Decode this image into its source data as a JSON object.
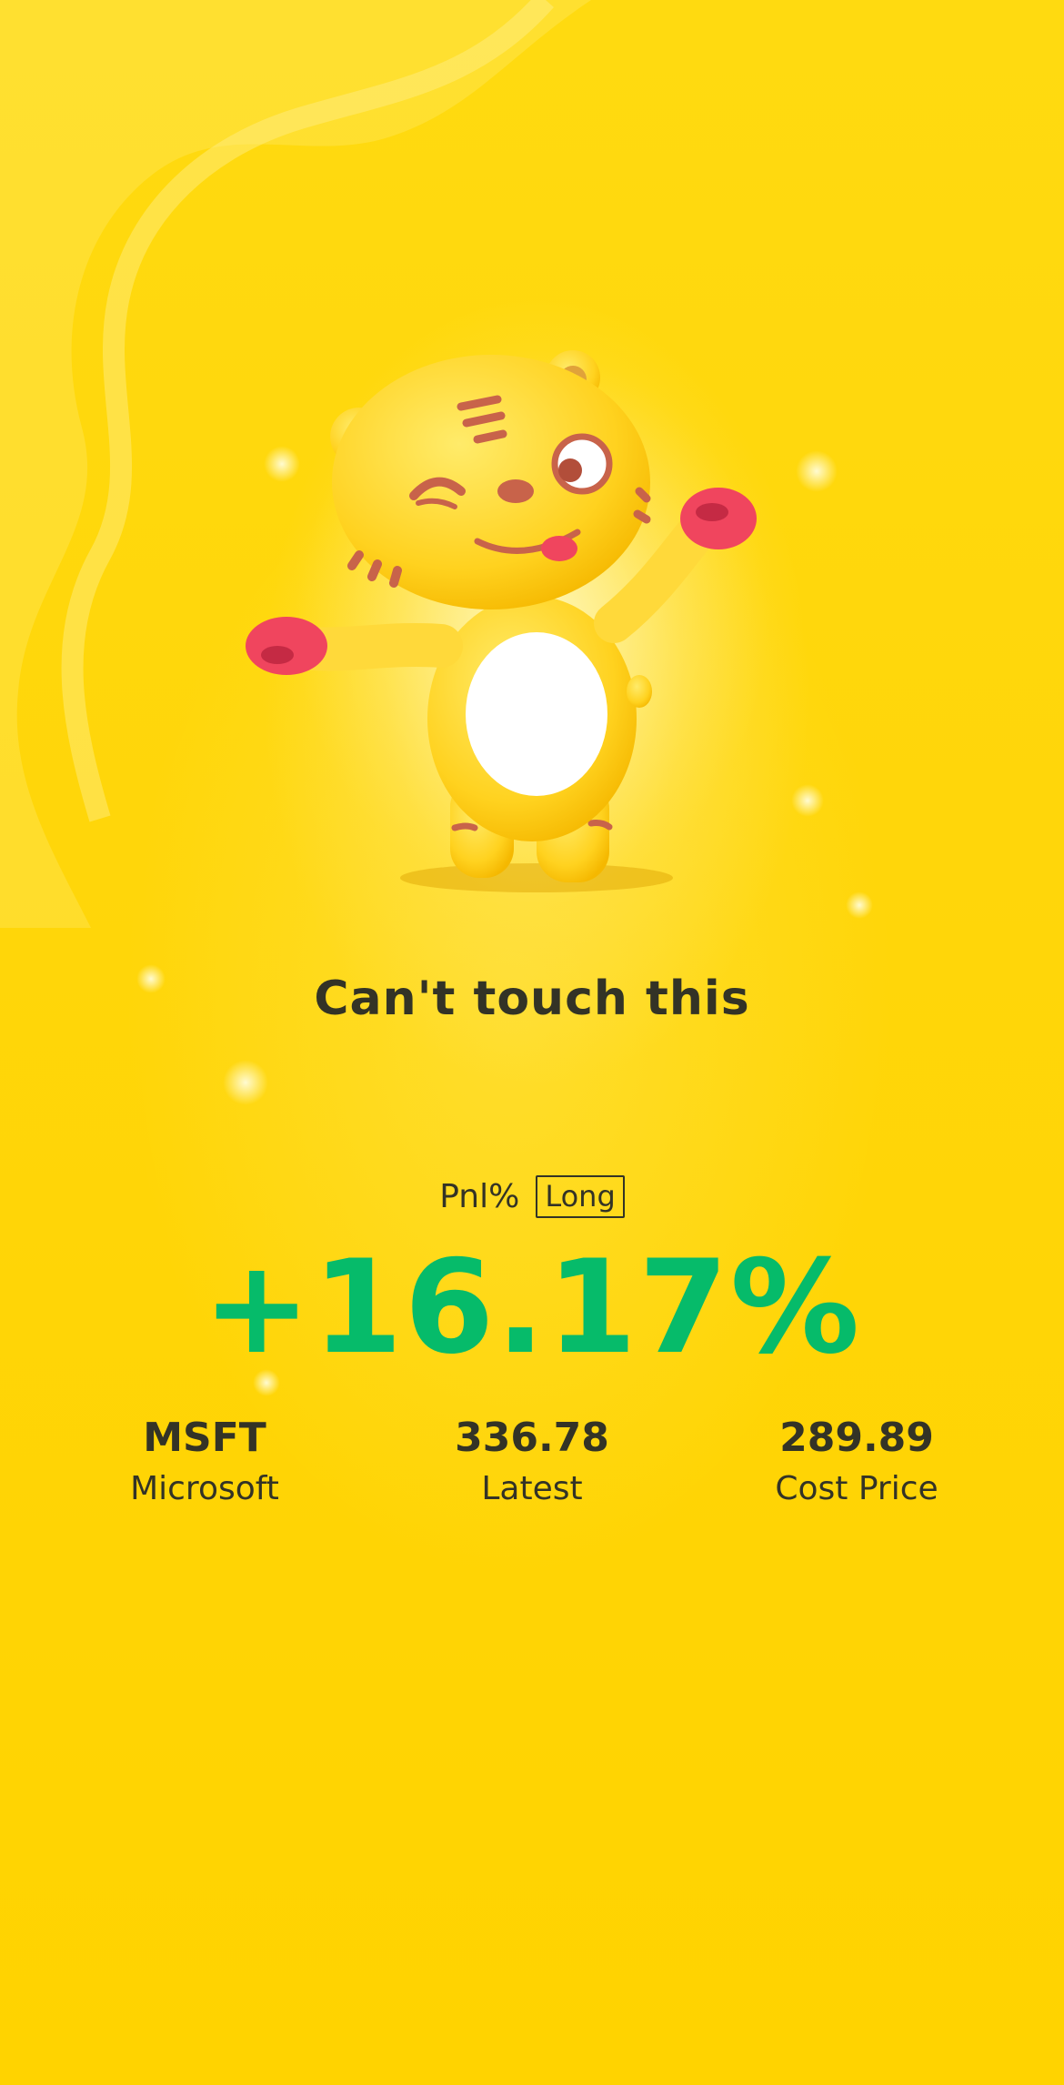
{
  "caption": "Can't touch this",
  "pnl": {
    "label": "Pnl%",
    "badge": "Long",
    "value": "+16.17%"
  },
  "stats": [
    {
      "value": "MSFT",
      "label": "Microsoft"
    },
    {
      "value": "336.78",
      "label": "Latest"
    },
    {
      "value": "289.89",
      "label": "Cost Price"
    }
  ],
  "colors": {
    "background": "#FFD500",
    "gain": "#06BB6A",
    "text": "#333326"
  },
  "icons": {
    "mascot": "tiger-mascot-icon"
  }
}
